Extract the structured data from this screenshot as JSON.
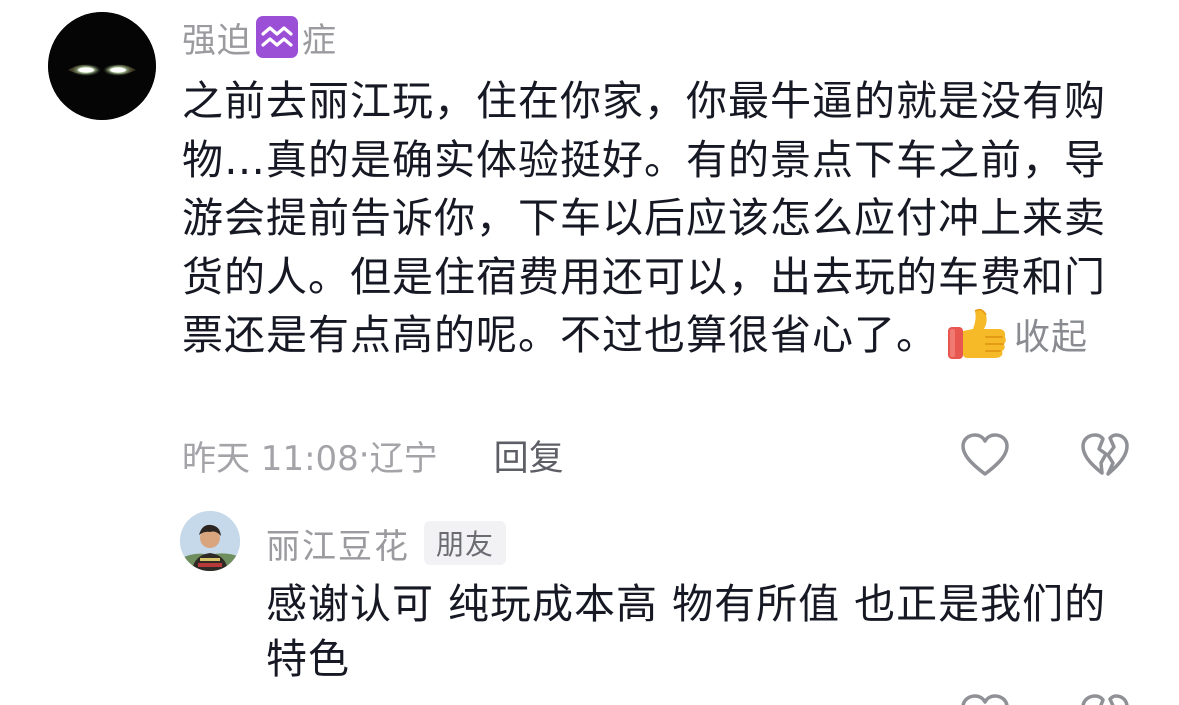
{
  "main_comment": {
    "username_prefix": "强迫",
    "username_suffix": "症",
    "zodiac_icon": "aquarius-icon",
    "text": "之前去丽江玩，住在你家，你最牛逼的就是没有购物…真的是确实体验挺好。有的景点下车之前，导游会提前告诉你，下车以后应该怎么应付冲上来卖货的人。但是住宿费用还可以，出去玩的车费和门票还是有点高的呢。不过也算很省心了。",
    "emoji": "thumbs-up-icon",
    "collapse_label": "收起",
    "timestamp": "昨天 11:08",
    "separator": "·",
    "location": "辽宁",
    "reply_label": "回复",
    "like_icon": "heart-icon",
    "dislike_icon": "broken-heart-icon"
  },
  "reply_comment": {
    "username": "丽江豆花",
    "tag": "朋友",
    "text": "感谢认可 纯玩成本高 物有所值 也正是我们的特色"
  },
  "colors": {
    "text_primary": "#161823",
    "text_secondary": "#9a9a9f",
    "zodiac_badge": "#9b4fd6",
    "tag_background": "#f2f2f4"
  }
}
